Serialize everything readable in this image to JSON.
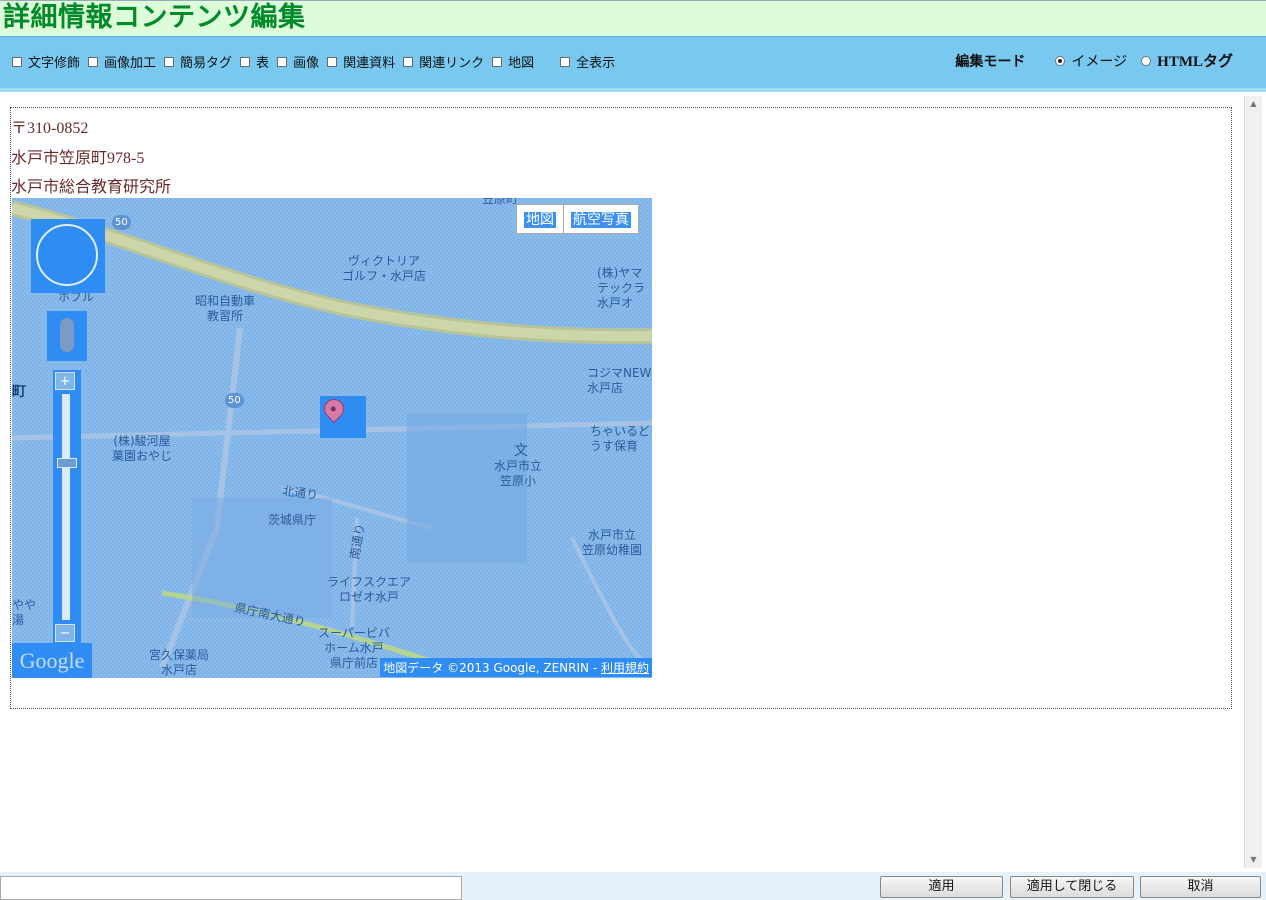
{
  "title": "詳細情報コンテンツ編集",
  "toolbar": {
    "checkboxes": [
      "文字修飾",
      "画像加工",
      "簡易タグ",
      "表",
      "画像",
      "関連資料",
      "関連リンク",
      "地図"
    ],
    "show_all": "全表示",
    "mode_label": "編集モード",
    "modes": [
      "イメージ",
      "HTMLタグ"
    ],
    "selected_mode": "イメージ"
  },
  "content": {
    "postal": "〒310-0852",
    "address": "水戸市笠原町978-5",
    "facility": "水戸市総合教育研究所"
  },
  "map": {
    "type_buttons": [
      "地図",
      "航空写真"
    ],
    "logo": "Google",
    "credit_text": "地図データ ©2013 Google, ZENRIN - ",
    "credit_link": "利用規約",
    "labels": {
      "victoria": "ヴィクトリア\nゴルフ・水戸店",
      "yamada": "(株)ヤマ\nテックラ\n水戸オ",
      "showa": "昭和自動車\n教習所",
      "kojima": "コジマNEW\n水戸店",
      "chairudo": "ちゃいるど\nうす保育",
      "surugaya": "(株)駿河屋\n菓園おやじ",
      "school": "水戸市立\n笠原小",
      "kindergarten": "水戸市立\n笠原幼稚園",
      "kitadori": "北通り",
      "pref_office": "茨城県庁",
      "minamidori": "南通り",
      "life": "ライフスクエア\nロゼオ水戸",
      "super": "スーパービバ\nホーム水戸\n県庁前店",
      "pref_ave": "県庁南大通り",
      "hokubu": "ホブル",
      "town": "町",
      "kubo": "宮久保薬局\n水戸店",
      "yaya": "やや\n湯",
      "route50a": "50",
      "route50b": "50",
      "bunsign": "文",
      "toplabel": "笠原町"
    }
  },
  "footer": {
    "apply": "適用",
    "apply_close": "適用して閉じる",
    "cancel": "取消"
  }
}
